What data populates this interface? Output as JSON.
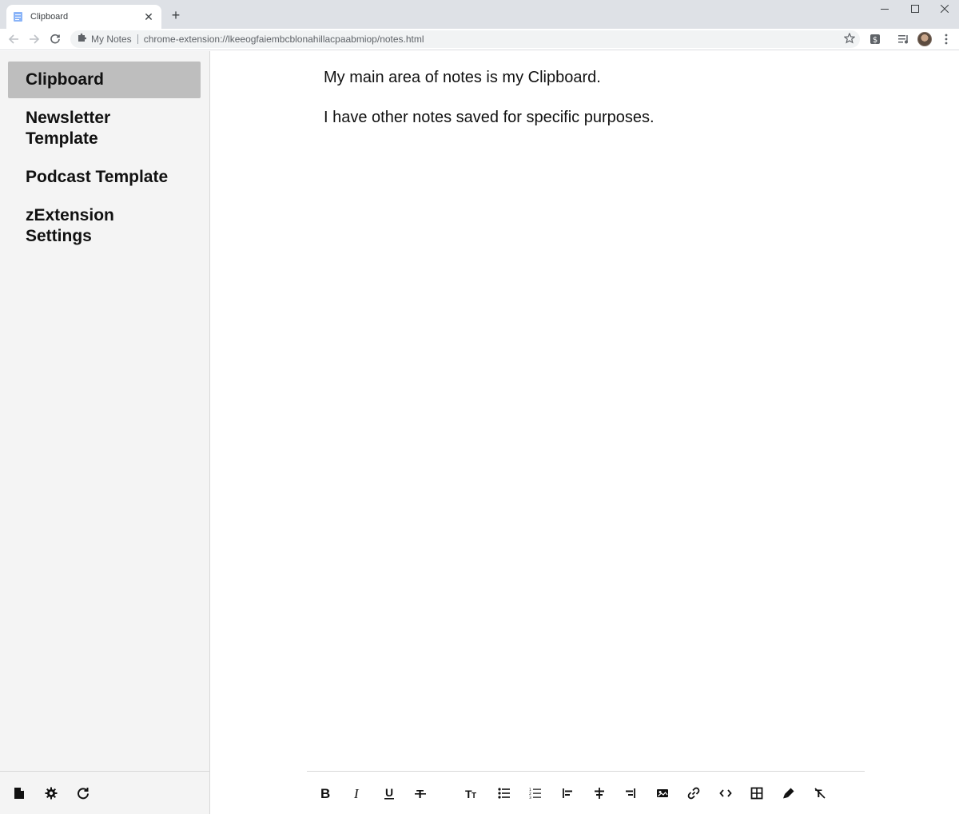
{
  "browser": {
    "tab_title": "Clipboard",
    "omnibox_site": "My Notes",
    "omnibox_url": "chrome-extension://lkeeogfaiembcblonahillacpaabmiop/notes.html"
  },
  "sidebar": {
    "notes": [
      {
        "label": "Clipboard",
        "active": true
      },
      {
        "label": "Newsletter Template",
        "active": false
      },
      {
        "label": "Podcast Template",
        "active": false
      },
      {
        "label": "zExtension Settings",
        "active": false
      }
    ]
  },
  "editor": {
    "paragraphs": [
      "My main area of notes is my Clipboard.",
      "I have other notes saved for specific purposes."
    ]
  },
  "format_toolbar": {
    "buttons": [
      "bold-icon",
      "italic-icon",
      "underline-icon",
      "strikethrough-icon",
      "text-size-icon",
      "bulleted-list-icon",
      "numbered-list-icon",
      "align-left-icon",
      "align-center-icon",
      "align-right-icon",
      "image-icon",
      "link-icon",
      "code-icon",
      "table-icon",
      "highlight-icon",
      "clear-format-icon"
    ]
  },
  "colors": {
    "sidebar_bg": "#f4f4f4",
    "active_note_bg": "#bebebe",
    "tabstrip_bg": "#dee1e6"
  }
}
